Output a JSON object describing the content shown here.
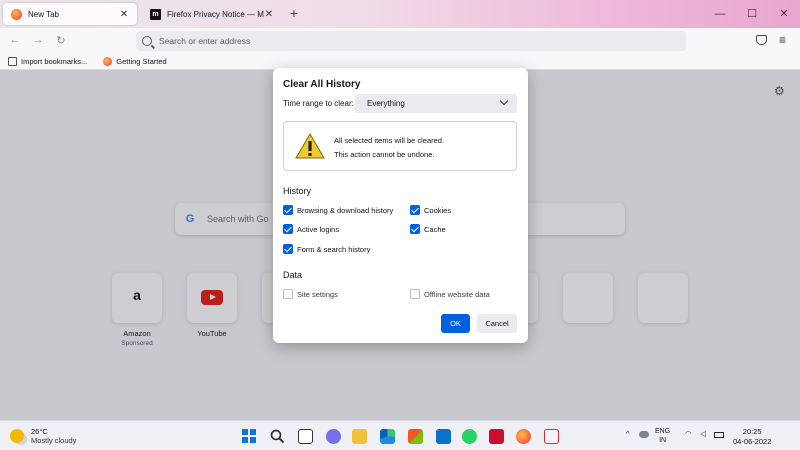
{
  "browser": {
    "tabs": [
      {
        "title": "New Tab",
        "close": "✕"
      },
      {
        "title": "Firefox Privacy Notice — Mozilla",
        "close": "✕",
        "favicon_text": "m"
      }
    ],
    "new_tab": "+",
    "window_buttons": {
      "minimize": "—",
      "maximize": "☐",
      "close": "✕"
    },
    "nav": {
      "back": "←",
      "forward": "→",
      "reload": "↻"
    },
    "urlbar": {
      "placeholder": "Search or enter address"
    },
    "menu": "≡",
    "bookmarks": [
      {
        "label": "Import bookmarks..."
      },
      {
        "label": "Getting Started"
      }
    ]
  },
  "newtab": {
    "settings_icon": "⚙",
    "search_placeholder": "Search with Go",
    "google_letter": "G",
    "tiles": [
      {
        "label": "Amazon",
        "sublabel": "Sponsored",
        "glyph": "a"
      },
      {
        "label": "YouTube"
      }
    ]
  },
  "dialog": {
    "title": "Clear All History",
    "time_range_label": "Time range to clear:",
    "time_range_value": "Everything",
    "warning_line1": "All selected items will be cleared.",
    "warning_line2": "This action cannot be undone.",
    "history_heading": "History",
    "history_items": [
      {
        "label": "Browsing & download history",
        "checked": true
      },
      {
        "label": "Cookies",
        "checked": true
      },
      {
        "label": "Active logins",
        "checked": true
      },
      {
        "label": "Cache",
        "checked": true
      },
      {
        "label": "Form & search history",
        "checked": true
      }
    ],
    "data_heading": "Data",
    "data_items": [
      {
        "label": "Site settings",
        "checked": false
      },
      {
        "label": "Offline website data",
        "checked": false
      }
    ],
    "ok_label": "OK",
    "cancel_label": "Cancel",
    "accent_color": "#0061e0"
  },
  "taskbar": {
    "weather_temp": "26°C",
    "weather_desc": "Mostly cloudy",
    "tray_chevron": "^",
    "language": "ENG",
    "region": "IN",
    "time": "20:25",
    "date": "04-06-2022"
  }
}
